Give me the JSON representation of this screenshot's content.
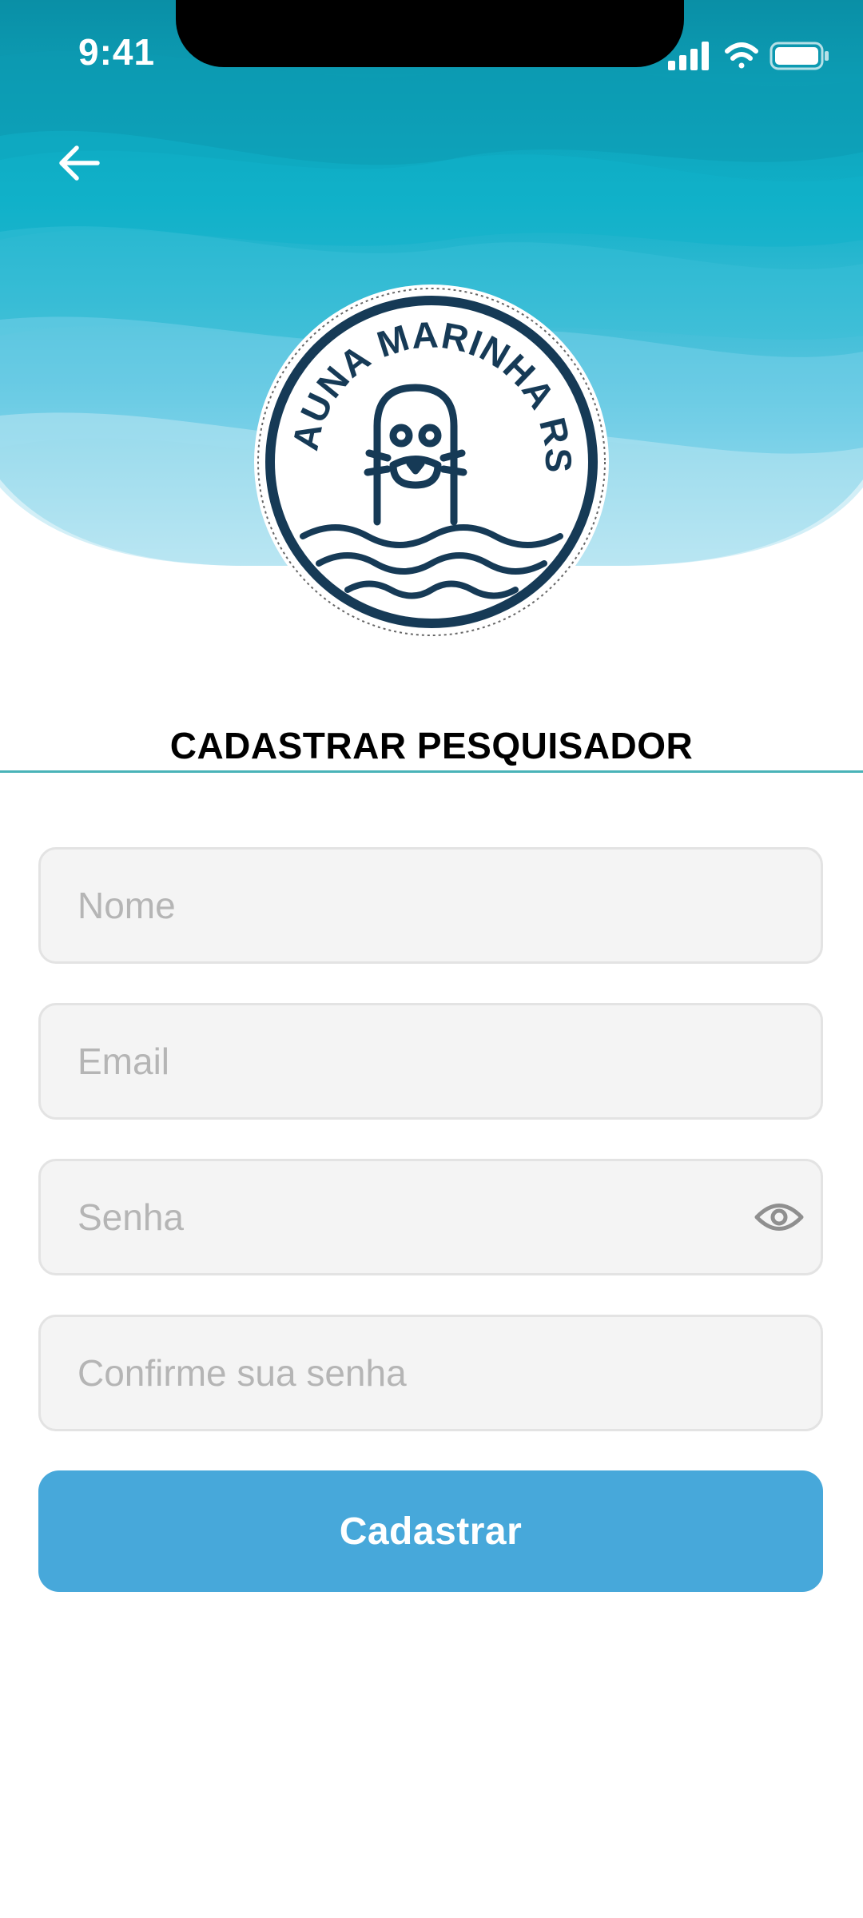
{
  "status_bar": {
    "time": "9:41"
  },
  "header": {
    "logo_text": "FAUNA MARINHA RS",
    "colors": {
      "wave_dark": "#0b97ae",
      "wave_mid": "#1bb6cc",
      "wave_light": "#9fdcee",
      "logo_navy": "#163a56"
    }
  },
  "page": {
    "title": "CADASTRAR PESQUISADOR"
  },
  "form": {
    "name_placeholder": "Nome",
    "email_placeholder": "Email",
    "password_placeholder": "Senha",
    "confirm_placeholder": "Confirme sua senha",
    "submit_label": "Cadastrar",
    "submit_color": "#47a8da"
  },
  "icons": {
    "back": "arrow-left-icon",
    "visibility": "eye-icon"
  }
}
